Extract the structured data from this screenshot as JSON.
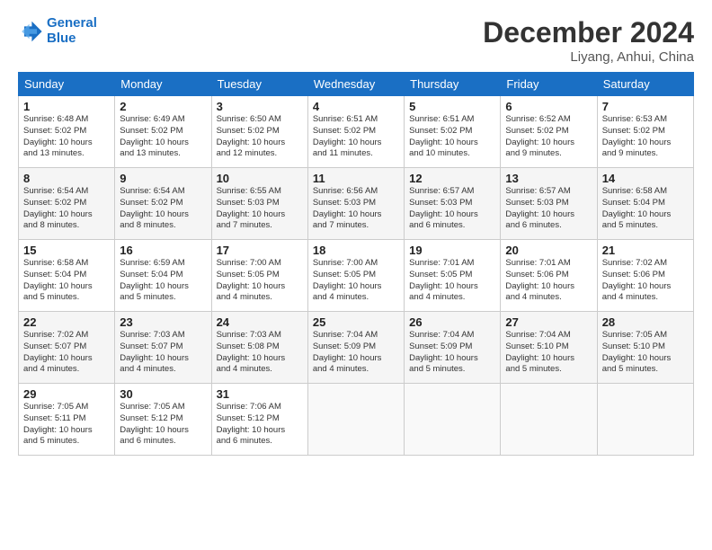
{
  "header": {
    "logo_line1": "General",
    "logo_line2": "Blue",
    "month_title": "December 2024",
    "location": "Liyang, Anhui, China"
  },
  "weekdays": [
    "Sunday",
    "Monday",
    "Tuesday",
    "Wednesday",
    "Thursday",
    "Friday",
    "Saturday"
  ],
  "weeks": [
    [
      {
        "day": "1",
        "info": "Sunrise: 6:48 AM\nSunset: 5:02 PM\nDaylight: 10 hours\nand 13 minutes."
      },
      {
        "day": "2",
        "info": "Sunrise: 6:49 AM\nSunset: 5:02 PM\nDaylight: 10 hours\nand 13 minutes."
      },
      {
        "day": "3",
        "info": "Sunrise: 6:50 AM\nSunset: 5:02 PM\nDaylight: 10 hours\nand 12 minutes."
      },
      {
        "day": "4",
        "info": "Sunrise: 6:51 AM\nSunset: 5:02 PM\nDaylight: 10 hours\nand 11 minutes."
      },
      {
        "day": "5",
        "info": "Sunrise: 6:51 AM\nSunset: 5:02 PM\nDaylight: 10 hours\nand 10 minutes."
      },
      {
        "day": "6",
        "info": "Sunrise: 6:52 AM\nSunset: 5:02 PM\nDaylight: 10 hours\nand 9 minutes."
      },
      {
        "day": "7",
        "info": "Sunrise: 6:53 AM\nSunset: 5:02 PM\nDaylight: 10 hours\nand 9 minutes."
      }
    ],
    [
      {
        "day": "8",
        "info": "Sunrise: 6:54 AM\nSunset: 5:02 PM\nDaylight: 10 hours\nand 8 minutes."
      },
      {
        "day": "9",
        "info": "Sunrise: 6:54 AM\nSunset: 5:02 PM\nDaylight: 10 hours\nand 8 minutes."
      },
      {
        "day": "10",
        "info": "Sunrise: 6:55 AM\nSunset: 5:03 PM\nDaylight: 10 hours\nand 7 minutes."
      },
      {
        "day": "11",
        "info": "Sunrise: 6:56 AM\nSunset: 5:03 PM\nDaylight: 10 hours\nand 7 minutes."
      },
      {
        "day": "12",
        "info": "Sunrise: 6:57 AM\nSunset: 5:03 PM\nDaylight: 10 hours\nand 6 minutes."
      },
      {
        "day": "13",
        "info": "Sunrise: 6:57 AM\nSunset: 5:03 PM\nDaylight: 10 hours\nand 6 minutes."
      },
      {
        "day": "14",
        "info": "Sunrise: 6:58 AM\nSunset: 5:04 PM\nDaylight: 10 hours\nand 5 minutes."
      }
    ],
    [
      {
        "day": "15",
        "info": "Sunrise: 6:58 AM\nSunset: 5:04 PM\nDaylight: 10 hours\nand 5 minutes."
      },
      {
        "day": "16",
        "info": "Sunrise: 6:59 AM\nSunset: 5:04 PM\nDaylight: 10 hours\nand 5 minutes."
      },
      {
        "day": "17",
        "info": "Sunrise: 7:00 AM\nSunset: 5:05 PM\nDaylight: 10 hours\nand 4 minutes."
      },
      {
        "day": "18",
        "info": "Sunrise: 7:00 AM\nSunset: 5:05 PM\nDaylight: 10 hours\nand 4 minutes."
      },
      {
        "day": "19",
        "info": "Sunrise: 7:01 AM\nSunset: 5:05 PM\nDaylight: 10 hours\nand 4 minutes."
      },
      {
        "day": "20",
        "info": "Sunrise: 7:01 AM\nSunset: 5:06 PM\nDaylight: 10 hours\nand 4 minutes."
      },
      {
        "day": "21",
        "info": "Sunrise: 7:02 AM\nSunset: 5:06 PM\nDaylight: 10 hours\nand 4 minutes."
      }
    ],
    [
      {
        "day": "22",
        "info": "Sunrise: 7:02 AM\nSunset: 5:07 PM\nDaylight: 10 hours\nand 4 minutes."
      },
      {
        "day": "23",
        "info": "Sunrise: 7:03 AM\nSunset: 5:07 PM\nDaylight: 10 hours\nand 4 minutes."
      },
      {
        "day": "24",
        "info": "Sunrise: 7:03 AM\nSunset: 5:08 PM\nDaylight: 10 hours\nand 4 minutes."
      },
      {
        "day": "25",
        "info": "Sunrise: 7:04 AM\nSunset: 5:09 PM\nDaylight: 10 hours\nand 4 minutes."
      },
      {
        "day": "26",
        "info": "Sunrise: 7:04 AM\nSunset: 5:09 PM\nDaylight: 10 hours\nand 5 minutes."
      },
      {
        "day": "27",
        "info": "Sunrise: 7:04 AM\nSunset: 5:10 PM\nDaylight: 10 hours\nand 5 minutes."
      },
      {
        "day": "28",
        "info": "Sunrise: 7:05 AM\nSunset: 5:10 PM\nDaylight: 10 hours\nand 5 minutes."
      }
    ],
    [
      {
        "day": "29",
        "info": "Sunrise: 7:05 AM\nSunset: 5:11 PM\nDaylight: 10 hours\nand 5 minutes."
      },
      {
        "day": "30",
        "info": "Sunrise: 7:05 AM\nSunset: 5:12 PM\nDaylight: 10 hours\nand 6 minutes."
      },
      {
        "day": "31",
        "info": "Sunrise: 7:06 AM\nSunset: 5:12 PM\nDaylight: 10 hours\nand 6 minutes."
      },
      {
        "day": "",
        "info": ""
      },
      {
        "day": "",
        "info": ""
      },
      {
        "day": "",
        "info": ""
      },
      {
        "day": "",
        "info": ""
      }
    ]
  ]
}
